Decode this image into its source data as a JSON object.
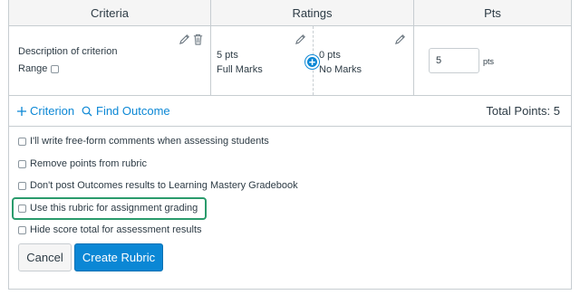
{
  "table": {
    "headers": {
      "criteria": "Criteria",
      "ratings": "Ratings",
      "pts": "Pts"
    },
    "criterion": {
      "description": "Description of criterion",
      "range_label": "Range",
      "ratings": [
        {
          "points": "5 pts",
          "description": "Full Marks"
        },
        {
          "points": "0 pts",
          "description": "No Marks"
        }
      ],
      "points_value": "5",
      "points_unit": "pts"
    }
  },
  "actions": {
    "add_criterion_label": "Criterion",
    "find_outcome_label": "Find Outcome",
    "total_points": "Total Points: 5"
  },
  "options": [
    {
      "label": "I'll write free-form comments when assessing students",
      "checked": false
    },
    {
      "label": "Remove points from rubric",
      "checked": false
    },
    {
      "label": "Don't post Outcomes results to Learning Mastery Gradebook",
      "checked": false
    },
    {
      "label": "Use this rubric for assignment grading",
      "checked": false,
      "highlighted": true
    },
    {
      "label": "Hide score total for assessment results",
      "checked": false
    }
  ],
  "buttons": {
    "cancel": "Cancel",
    "create": "Create Rubric"
  },
  "colors": {
    "accent": "#0b87d5",
    "highlight": "#2a9b6c",
    "border": "#c7cdd1"
  }
}
